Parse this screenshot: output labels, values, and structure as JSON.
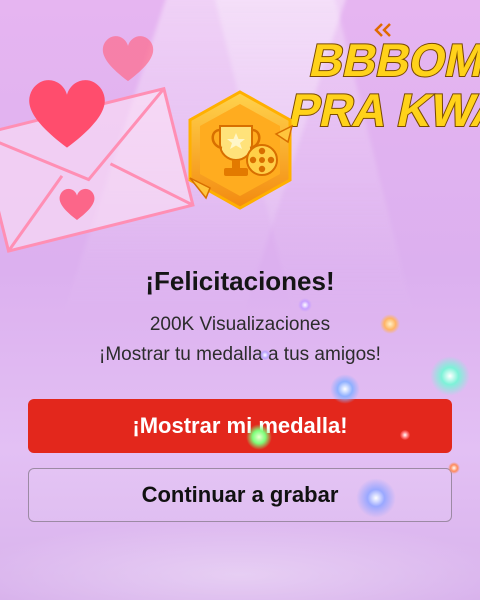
{
  "brand": {
    "line1": "BBBOM",
    "line2": "PRA KWAI"
  },
  "dialog": {
    "title": "¡Felicitaciones!",
    "milestone": "200K Visualizaciones",
    "message": "¡Mostrar tu medalla a tus amigos!"
  },
  "actions": {
    "primary_label": "¡Mostrar mi medalla!",
    "secondary_label": "Continuar a grabar"
  },
  "colors": {
    "primary": "#e3271c",
    "background": "#e6b5f1",
    "brand_yellow": "#ffd21a",
    "medal_orange": "#f7a21b"
  },
  "icons": {
    "medal": "trophy-film-medal-icon",
    "decor": [
      "heart-icon",
      "envelope-icon"
    ]
  }
}
